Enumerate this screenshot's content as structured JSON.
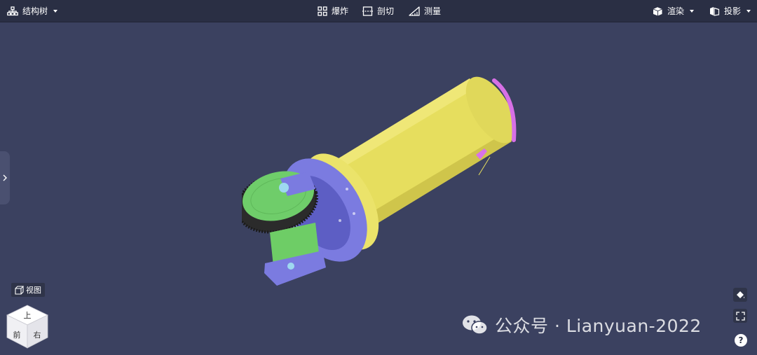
{
  "toolbar": {
    "structure_tree": "结构树",
    "explode": "爆炸",
    "section": "剖切",
    "measure": "测量",
    "render": "渲染",
    "projection": "投影"
  },
  "viewer": {
    "view_label": "视图",
    "cube_faces": {
      "top": "上",
      "front": "前",
      "right": "右"
    },
    "help": "?"
  },
  "watermark": {
    "text": "公众号 · Lianyuan-2022"
  },
  "colors": {
    "background": "#3b4160",
    "toolbar": "#2a2f44",
    "cylinder": "#e8e060",
    "flange": "#7f7fe6",
    "gear": "#2d2d2d",
    "bracket": "#6fcf6a",
    "end_cap": "#d873e8"
  }
}
